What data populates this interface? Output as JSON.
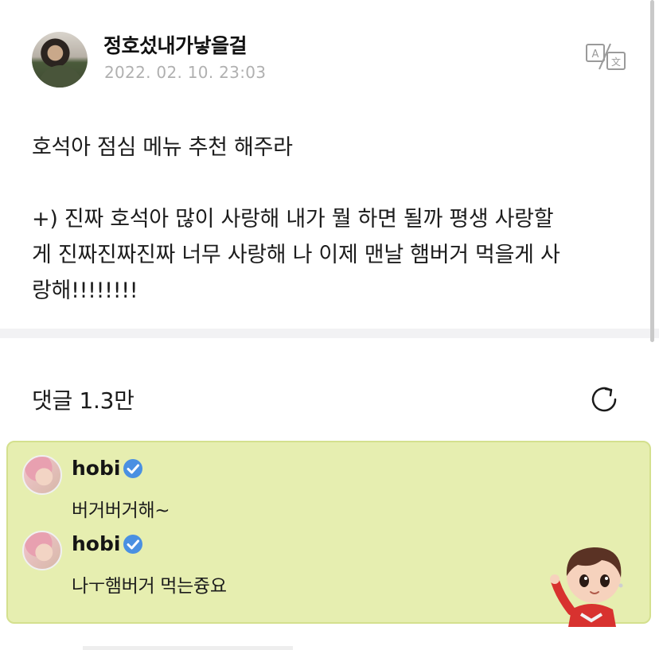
{
  "post": {
    "author": "정호섰내가낳을걸",
    "date": "2022. 02. 10. 23:03",
    "line1": "호석아 점심 메뉴 추천 해주라",
    "line2": "+) 진짜 호석아 많이 사랑해 내가 뭘 하면 될까 평생 사랑할",
    "line3": "게 진짜진짜진짜 너무 사랑해 나 이제 맨날 햄버거 먹을게 사",
    "line4": "랑해!!!!!!!!"
  },
  "comments": {
    "title": "댓글 1.3만",
    "replies": [
      {
        "name": "hobi",
        "text": "버거버거해~"
      },
      {
        "name": "hobi",
        "text": "나ㅜ햄버거 먹는즁요"
      }
    ]
  },
  "icons": {
    "translate": "translate-icon",
    "refresh": "refresh-icon",
    "verified": "verified-badge-icon"
  },
  "colors": {
    "pinned_bg": "#e6eeb0",
    "verified_blue": "#4a90e2",
    "date_gray": "#b0b0b0"
  }
}
